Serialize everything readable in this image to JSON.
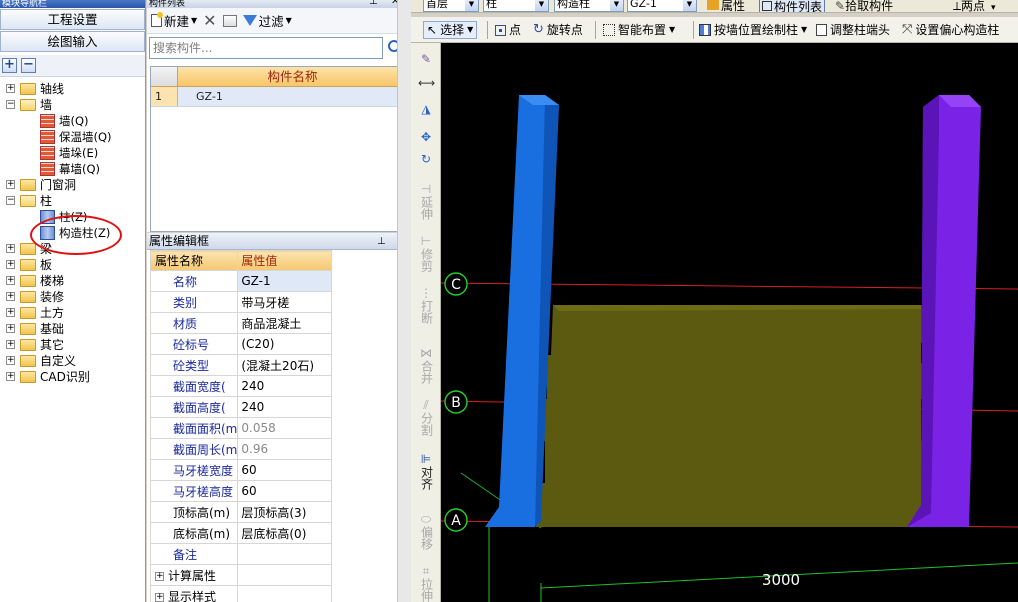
{
  "nav": {
    "title": "模块导航栏",
    "project_settings": "工程设置",
    "drawing_input": "绘图输入",
    "tree": [
      {
        "label": "轴线",
        "level": 0,
        "expanded": false
      },
      {
        "label": "墙",
        "level": 0,
        "expanded": true
      },
      {
        "label": "墙(Q)",
        "level": 1,
        "icon": "brick-wall-icon"
      },
      {
        "label": "保温墙(Q)",
        "level": 1,
        "icon": "insulation-wall-icon"
      },
      {
        "label": "墙垛(E)",
        "level": 1,
        "icon": "wall-pier-icon"
      },
      {
        "label": "幕墙(Q)",
        "level": 1,
        "icon": "curtain-wall-icon"
      },
      {
        "label": "门窗洞",
        "level": 0,
        "expanded": false
      },
      {
        "label": "柱",
        "level": 0,
        "expanded": true
      },
      {
        "label": "柱(Z)",
        "level": 1,
        "icon": "column-icon"
      },
      {
        "label": "构造柱(Z)",
        "level": 1,
        "icon": "structural-column-icon"
      },
      {
        "label": "梁",
        "level": 0,
        "expanded": false
      },
      {
        "label": "板",
        "level": 0,
        "expanded": false
      },
      {
        "label": "楼梯",
        "level": 0,
        "expanded": false
      },
      {
        "label": "装修",
        "level": 0,
        "expanded": false
      },
      {
        "label": "土方",
        "level": 0,
        "expanded": false
      },
      {
        "label": "基础",
        "level": 0,
        "expanded": false
      },
      {
        "label": "其它",
        "level": 0,
        "expanded": false
      },
      {
        "label": "自定义",
        "level": 0,
        "expanded": false
      },
      {
        "label": "CAD识别",
        "level": 0,
        "expanded": false
      }
    ]
  },
  "component_list": {
    "title": "构件列表",
    "new_label": "新建",
    "filter_label": "过滤",
    "search_placeholder": "搜索构件...",
    "column_header": "构件名称",
    "rows": [
      {
        "index": "1",
        "name": "GZ-1"
      }
    ]
  },
  "properties": {
    "title": "属性编辑框",
    "header_name": "属性名称",
    "header_value": "属性值",
    "rows": [
      {
        "name": "名称",
        "value": "GZ-1",
        "style": "blue",
        "selected": true
      },
      {
        "name": "类别",
        "value": "带马牙槎",
        "style": "blue"
      },
      {
        "name": "材质",
        "value": "商品混凝土",
        "style": "blue"
      },
      {
        "name": "砼标号",
        "value": "(C20)",
        "style": "blue"
      },
      {
        "name": "砼类型",
        "value": "(混凝土20石)",
        "style": "blue"
      },
      {
        "name": "截面宽度(",
        "value": "240",
        "style": "blue"
      },
      {
        "name": "截面高度(",
        "value": "240",
        "style": "blue"
      },
      {
        "name": "截面面积(m",
        "value": "0.058",
        "style": "gray"
      },
      {
        "name": "截面周长(m",
        "value": "0.96",
        "style": "gray"
      },
      {
        "name": "马牙槎宽度",
        "value": "60",
        "style": "blue"
      },
      {
        "name": "马牙槎高度",
        "value": "60",
        "style": "blue"
      },
      {
        "name": "顶标高(m)",
        "value": "层顶标高(3)",
        "style": "black"
      },
      {
        "name": "底标高(m)",
        "value": "层底标高(0)",
        "style": "black"
      },
      {
        "name": "备注",
        "value": "",
        "style": "blue"
      },
      {
        "name": "计算属性",
        "value": "",
        "style": "group"
      },
      {
        "name": "显示样式",
        "value": "",
        "style": "group"
      }
    ]
  },
  "toolbar_top": {
    "floor": "首层",
    "category": "柱",
    "type": "构造柱",
    "component": "GZ-1",
    "attribute": "属性",
    "component_list": "构件列表",
    "pick_component": "拾取构件",
    "two_points": "两点"
  },
  "toolbar_draw": {
    "select": "选择",
    "point": "点",
    "rotate_point": "旋转点",
    "smart_layout": "智能布置",
    "draw_by_wall": "按墙位置绘制柱",
    "adjust_column_end": "调整柱端头",
    "set_eccentric": "设置偏心构造柱"
  },
  "vertical_tools": {
    "extend": "延伸",
    "trim": "修剪",
    "break": "打断",
    "merge": "合并",
    "split": "分割",
    "align": "对齐",
    "offset": "偏移",
    "stretch": "拉伸"
  },
  "viewport": {
    "axis_c": "C",
    "axis_b": "B",
    "axis_a": "A",
    "dimension": "3000",
    "colors": {
      "left_column": "#1a6fe0",
      "right_column": "#7a22e6",
      "wall": "#5c5a10",
      "axis_line": "#d82020",
      "grid_green": "#1fbf2f"
    }
  }
}
